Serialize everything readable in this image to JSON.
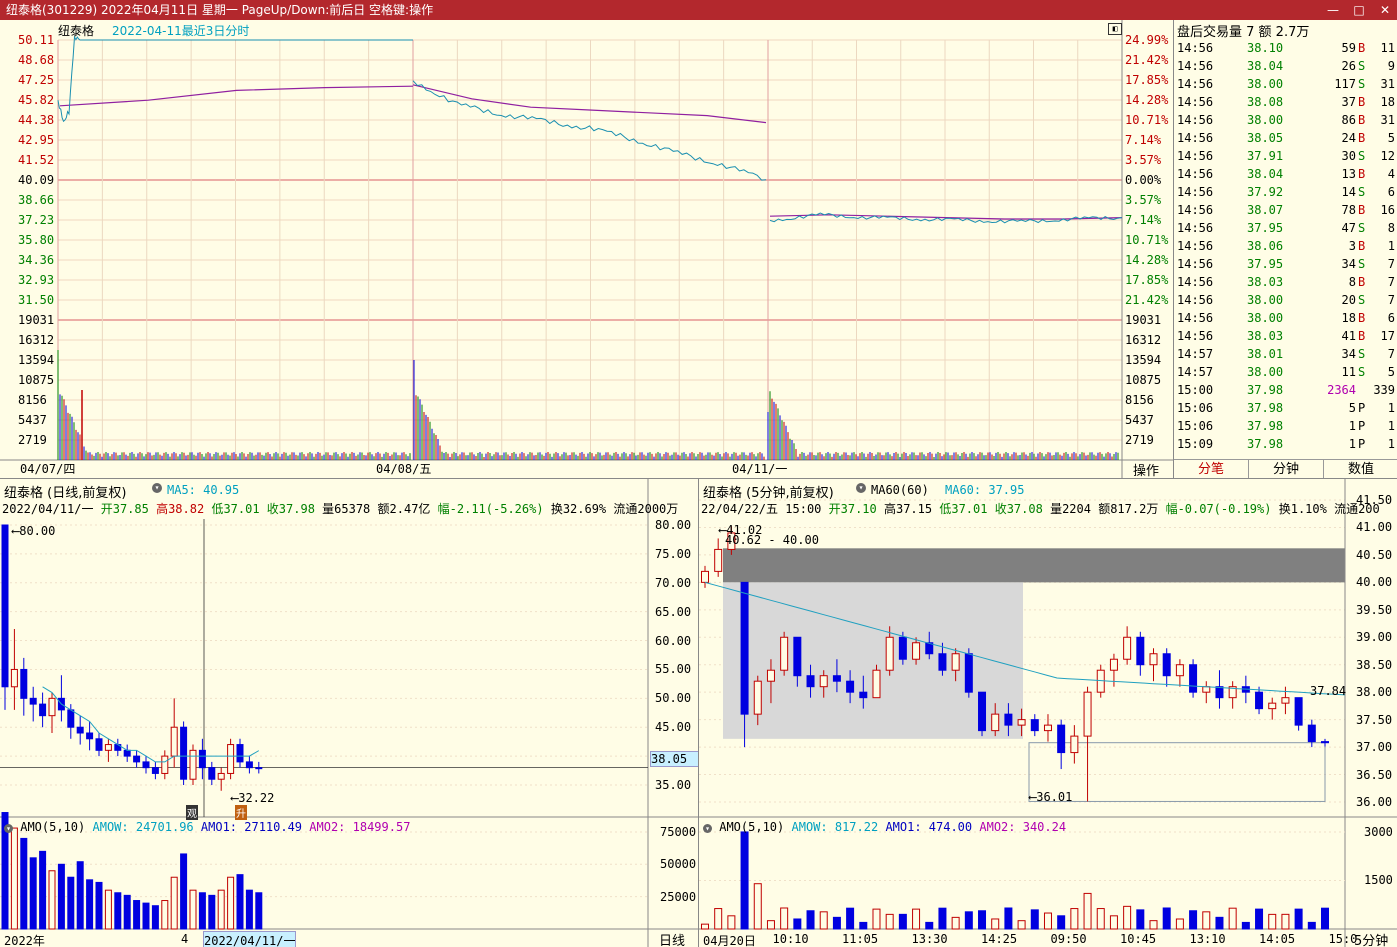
{
  "window": {
    "title": "纽泰格(301229) 2022年04月11日 星期一 PageUp/Down:前后日 空格键:操作"
  },
  "intraday": {
    "name": "纽泰格",
    "subtitle": "2022-04-11最近3日分时",
    "price_ticks": [
      "50.11",
      "48.68",
      "47.25",
      "45.82",
      "44.38",
      "42.95",
      "41.52",
      "40.09",
      "38.66",
      "37.23",
      "35.80",
      "34.36",
      "32.93",
      "31.50"
    ],
    "pct_ticks": [
      "24.99%",
      "21.42%",
      "17.85%",
      "14.28%",
      "10.71%",
      "7.14%",
      "3.57%",
      "0.00%",
      "3.57%",
      "7.14%",
      "10.71%",
      "14.28%",
      "17.85%",
      "21.42%"
    ],
    "vol_ticks": [
      "19031",
      "16312",
      "13594",
      "10875",
      "8156",
      "5437",
      "2719"
    ],
    "date_labels": [
      "04/07/四",
      "04/08/五",
      "04/11/一"
    ],
    "operate_button": "操作"
  },
  "trades": {
    "header": "盘后交易量 7 额 2.7万",
    "rows": [
      {
        "time": "14:56",
        "price": "38.10",
        "vol": "59",
        "bs": "B",
        "n": "11"
      },
      {
        "time": "14:56",
        "price": "38.04",
        "vol": "26",
        "bs": "S",
        "n": "9"
      },
      {
        "time": "14:56",
        "price": "38.00",
        "vol": "117",
        "bs": "S",
        "n": "31"
      },
      {
        "time": "14:56",
        "price": "38.08",
        "vol": "37",
        "bs": "B",
        "n": "18"
      },
      {
        "time": "14:56",
        "price": "38.00",
        "vol": "86",
        "bs": "B",
        "n": "31"
      },
      {
        "time": "14:56",
        "price": "38.05",
        "vol": "24",
        "bs": "B",
        "n": "5"
      },
      {
        "time": "14:56",
        "price": "37.91",
        "vol": "30",
        "bs": "S",
        "n": "12"
      },
      {
        "time": "14:56",
        "price": "38.04",
        "vol": "13",
        "bs": "B",
        "n": "4"
      },
      {
        "time": "14:56",
        "price": "37.92",
        "vol": "14",
        "bs": "S",
        "n": "6"
      },
      {
        "time": "14:56",
        "price": "38.07",
        "vol": "78",
        "bs": "B",
        "n": "16"
      },
      {
        "time": "14:56",
        "price": "37.95",
        "vol": "47",
        "bs": "S",
        "n": "8"
      },
      {
        "time": "14:56",
        "price": "38.06",
        "vol": "3",
        "bs": "B",
        "n": "1"
      },
      {
        "time": "14:56",
        "price": "37.95",
        "vol": "34",
        "bs": "S",
        "n": "7"
      },
      {
        "time": "14:56",
        "price": "38.03",
        "vol": "8",
        "bs": "B",
        "n": "7"
      },
      {
        "time": "14:56",
        "price": "38.00",
        "vol": "20",
        "bs": "S",
        "n": "7"
      },
      {
        "time": "14:56",
        "price": "38.00",
        "vol": "18",
        "bs": "B",
        "n": "6"
      },
      {
        "time": "14:56",
        "price": "38.03",
        "vol": "41",
        "bs": "B",
        "n": "17"
      },
      {
        "time": "14:57",
        "price": "38.01",
        "vol": "34",
        "bs": "S",
        "n": "7"
      },
      {
        "time": "14:57",
        "price": "38.00",
        "vol": "11",
        "bs": "S",
        "n": "5"
      },
      {
        "time": "15:00",
        "price": "37.98",
        "vol": "2364",
        "bs": "",
        "n": "339"
      },
      {
        "time": "15:06",
        "price": "37.98",
        "vol": "5",
        "bs": "P",
        "n": "1"
      },
      {
        "time": "15:06",
        "price": "37.98",
        "vol": "1",
        "bs": "P",
        "n": "1"
      },
      {
        "time": "15:09",
        "price": "37.98",
        "vol": "1",
        "bs": "P",
        "n": "1"
      }
    ],
    "tabs": [
      "分笔",
      "分钟",
      "数值"
    ]
  },
  "daily": {
    "header": "纽泰格 (日线,前复权)",
    "ma_label": "MA5: 40.95",
    "info": {
      "date": "2022/04/11/一",
      "open": "开37.85",
      "high": "高38.82",
      "low": "低37.01",
      "close": "收37.98",
      "vol": "量65378",
      "amt": "额2.47亿",
      "chg": "幅-2.11(-5.26%)",
      "rest": "换32.69% 流通2000万"
    },
    "price_ticks": [
      "80.00",
      "75.00",
      "70.00",
      "65.00",
      "60.00",
      "55.00",
      "50.00",
      "45.00",
      "35.00"
    ],
    "cursor_price": "38.05",
    "max_label": "80.00",
    "min_label": "32.22",
    "tag1": "观",
    "tag2": "升",
    "amo_header": "AMO(5,10)",
    "amo_values": {
      "amow": "AMOW: 24701.96",
      "amo1": "AMO1: 27110.49",
      "amo2": "AMO2: 18499.57"
    },
    "amo_ticks": [
      "75000",
      "50000",
      "25000"
    ],
    "bottom_labels": [
      "2022年",
      "4",
      "2022/04/11/一"
    ],
    "period_label": "日线"
  },
  "min5": {
    "header": "纽泰格 (5分钟,前复权)",
    "ma_label": "MA60(60)",
    "ma_value": "MA60: 37.95",
    "info": {
      "date": "22/04/22/五",
      "time": "15:00",
      "open": "开37.10",
      "high": "高37.15",
      "low": "低37.01",
      "close": "收37.08",
      "vol": "量2204",
      "amt": "额817.2万",
      "chg": "幅-0.07(-0.19%)",
      "rest": "换1.10% 流通200"
    },
    "price_ticks": [
      "41.50",
      "41.00",
      "40.50",
      "40.00",
      "39.50",
      "39.00",
      "38.50",
      "38.00",
      "37.50",
      "37.00",
      "36.50",
      "36.00"
    ],
    "high_label": "41.02",
    "range_label": "40.62 - 40.00",
    "last_label": "37.84",
    "low_label": "36.01",
    "amo_header": "AMO(5,10)",
    "amo_values": {
      "amow": "AMOW: 817.22",
      "amo1": "AMO1: 474.00",
      "amo2": "AMO2: 340.24"
    },
    "amo_ticks": [
      "3000",
      "1500"
    ],
    "time_labels": [
      "04月20日",
      "10:10",
      "11:05",
      "13:30",
      "14:25",
      "09:50",
      "10:45",
      "13:10",
      "14:05",
      "15:0"
    ],
    "period_label": "5分钟"
  },
  "colors": {
    "up": "#c00000",
    "down": "#0000e0",
    "price_line": "#1a8fb0",
    "avg_line": "#9020a0",
    "ma_cyan": "#20a0c0",
    "grid_red": "#e8a0a0"
  },
  "chart_data": [
    {
      "type": "line",
      "title": "2022-04-11最近3日分时",
      "note": "3-day intraday price/avg lines with volume bars",
      "days": [
        "04/07",
        "04/08",
        "04/11"
      ],
      "ylim": [
        31.5,
        50.11
      ],
      "prev_close": 40.09,
      "series": [
        {
          "name": "price",
          "day1": [
            45.8,
            44.4,
            45.0,
            50.11,
            50.11
          ],
          "day2": [
            47.2,
            45.5,
            44.8,
            44.3,
            43.8,
            43.0,
            42.0,
            41.2,
            40.1
          ],
          "day3": [
            37.2,
            37.6,
            37.4,
            37.3,
            37.2,
            37.1,
            37.3,
            37.4
          ]
        },
        {
          "name": "avg",
          "day1": [
            45.4,
            45.8,
            46.5,
            46.7,
            46.8
          ],
          "day2": [
            46.9,
            45.9,
            45.3,
            45.1,
            44.9,
            44.7,
            44.2
          ],
          "day3": [
            37.5,
            37.6,
            37.5,
            37.4,
            37.3,
            37.3,
            37.4
          ]
        }
      ]
    },
    {
      "type": "candlestick",
      "title": "纽泰格 (日线,前复权)",
      "ylim": [
        32,
        82
      ],
      "candles": [
        [
          80,
          80,
          48,
          52
        ],
        [
          52,
          62,
          48,
          55
        ],
        [
          55,
          57,
          47,
          50
        ],
        [
          50,
          52,
          46,
          49
        ],
        [
          49,
          51,
          45,
          47
        ],
        [
          47,
          51,
          44,
          50
        ],
        [
          50,
          54,
          46,
          48
        ],
        [
          48,
          49,
          43,
          45
        ],
        [
          45,
          47,
          42,
          44
        ],
        [
          44,
          46,
          41,
          43
        ],
        [
          43,
          44,
          40,
          41
        ],
        [
          41,
          43,
          39,
          42
        ],
        [
          42,
          43,
          40,
          41
        ],
        [
          41,
          42,
          39,
          40
        ],
        [
          40,
          41,
          38,
          39
        ],
        [
          39,
          40,
          37,
          38
        ],
        [
          38,
          39,
          36,
          37
        ],
        [
          37,
          41,
          36,
          40
        ],
        [
          40,
          50,
          38,
          45
        ],
        [
          45,
          46,
          35,
          36
        ],
        [
          36,
          42,
          35,
          41
        ],
        [
          41,
          43,
          36,
          38
        ],
        [
          38,
          39,
          35,
          36
        ],
        [
          36,
          38,
          34,
          37
        ],
        [
          37,
          43,
          36,
          42
        ],
        [
          42,
          43,
          38,
          39
        ],
        [
          39,
          40,
          37,
          38
        ],
        [
          38,
          39,
          37,
          37.98
        ]
      ],
      "ma5": [
        null,
        null,
        null,
        null,
        52,
        51,
        49,
        48,
        47,
        46,
        44,
        43,
        42,
        41,
        41,
        40,
        39,
        39,
        40,
        40,
        40,
        40,
        40,
        40,
        40,
        40,
        40,
        40.95
      ]
    },
    {
      "type": "candlestick",
      "title": "纽泰格 (5分钟,前复权)",
      "ylim": [
        35.9,
        41.6
      ],
      "candles": [
        [
          40,
          40.3,
          39.9,
          40.2
        ],
        [
          40.2,
          40.8,
          40.1,
          40.6
        ],
        [
          40.6,
          41.02,
          40.5,
          40.9
        ],
        [
          40,
          40,
          37,
          37.6
        ],
        [
          37.6,
          38.3,
          37.4,
          38.2
        ],
        [
          38.2,
          38.6,
          37.8,
          38.4
        ],
        [
          38.4,
          39.1,
          38.3,
          39
        ],
        [
          39,
          39,
          38.1,
          38.3
        ],
        [
          38.3,
          38.5,
          37.9,
          38.1
        ],
        [
          38.1,
          38.4,
          37.9,
          38.3
        ],
        [
          38.3,
          38.6,
          38,
          38.2
        ],
        [
          38.2,
          38.4,
          37.8,
          38
        ],
        [
          38,
          38.3,
          37.7,
          37.9
        ],
        [
          37.9,
          38.5,
          37.9,
          38.4
        ],
        [
          38.4,
          39.2,
          38.3,
          39
        ],
        [
          39,
          39.1,
          38.5,
          38.6
        ],
        [
          38.6,
          39,
          38.5,
          38.9
        ],
        [
          38.9,
          39.1,
          38.6,
          38.7
        ],
        [
          38.7,
          38.9,
          38.3,
          38.4
        ],
        [
          38.4,
          38.8,
          38.2,
          38.7
        ],
        [
          38.7,
          38.8,
          37.9,
          38
        ],
        [
          38,
          38,
          37.2,
          37.3
        ],
        [
          37.3,
          37.8,
          37.2,
          37.6
        ],
        [
          37.6,
          37.8,
          37.2,
          37.4
        ],
        [
          37.4,
          37.7,
          37.2,
          37.5
        ],
        [
          37.5,
          37.6,
          37.2,
          37.3
        ],
        [
          37.3,
          37.6,
          37.1,
          37.4
        ],
        [
          37.4,
          37.5,
          36.6,
          36.9
        ],
        [
          36.9,
          37.4,
          36.7,
          37.2
        ],
        [
          37.2,
          38.1,
          36.01,
          38
        ],
        [
          38,
          38.5,
          37.9,
          38.4
        ],
        [
          38.4,
          38.7,
          38.1,
          38.6
        ],
        [
          38.6,
          39.2,
          38.5,
          39
        ],
        [
          39,
          39.1,
          38.3,
          38.5
        ],
        [
          38.5,
          38.8,
          38.2,
          38.7
        ],
        [
          38.7,
          38.8,
          38.1,
          38.3
        ],
        [
          38.3,
          38.6,
          38.1,
          38.5
        ],
        [
          38.5,
          38.6,
          37.9,
          38.0
        ],
        [
          38,
          38.2,
          37.8,
          38.1
        ],
        [
          38.1,
          38.4,
          37.7,
          37.9
        ],
        [
          37.9,
          38.2,
          37.7,
          38.1
        ],
        [
          38.1,
          38.3,
          37.8,
          38.0
        ],
        [
          38,
          38.1,
          37.6,
          37.7
        ],
        [
          37.7,
          37.9,
          37.5,
          37.8
        ],
        [
          37.8,
          38.1,
          37.6,
          37.9
        ],
        [
          37.9,
          37.9,
          37.3,
          37.4
        ],
        [
          37.4,
          37.5,
          37.0,
          37.1
        ],
        [
          37.1,
          37.15,
          37.01,
          37.08
        ]
      ],
      "ma60_start": 40.0,
      "ma60_end": 37.95
    }
  ]
}
